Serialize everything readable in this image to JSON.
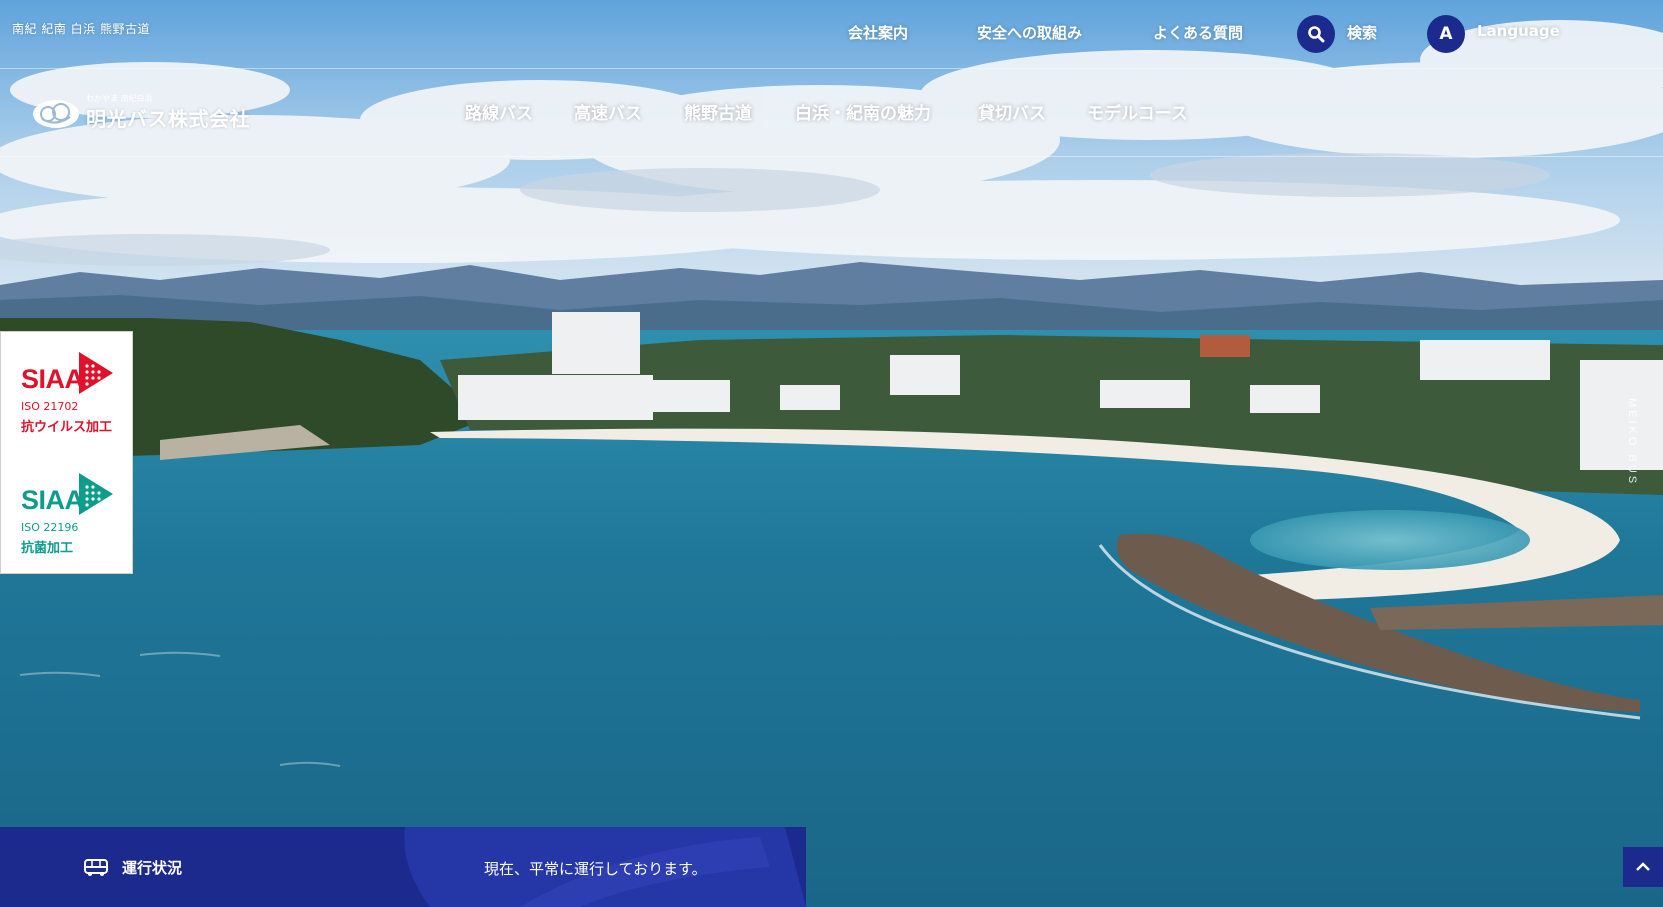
{
  "header": {
    "region_text": "南紀 紀南 白浜 熊野古道",
    "utility_links": [
      {
        "label": "会社案内"
      },
      {
        "label": "安全への取組み"
      },
      {
        "label": "よくある質問"
      }
    ],
    "search": {
      "icon": "search-icon",
      "label": "検索"
    },
    "language": {
      "icon_letter": "A",
      "label": "Language"
    }
  },
  "logo": {
    "ruby": "わかやま 南紀白浜",
    "name": "明光バス株式会社"
  },
  "nav": {
    "items": [
      {
        "label": "路線バス"
      },
      {
        "label": "高速バス"
      },
      {
        "label": "熊野古道"
      },
      {
        "label": "白浜・紀南の魅力"
      },
      {
        "label": "貸切バス"
      },
      {
        "label": "モデルコース"
      }
    ]
  },
  "badges": [
    {
      "title": "SIAA",
      "iso": "ISO 21702",
      "label": "抗ウイルス加工",
      "color": "#e0112b"
    },
    {
      "title": "SIAA",
      "iso": "ISO 22196",
      "label": "抗菌加工",
      "color": "#0e9c8c"
    }
  ],
  "vertical_brand": "MEIKO BUS",
  "status": {
    "icon": "bus-icon",
    "label": "運行状況",
    "message": "現在、平常に運行しております。"
  },
  "back_to_top": {
    "icon": "chevron-up-icon"
  },
  "colors": {
    "navy": "#1b2a8c",
    "siaa_red": "#e0112b",
    "siaa_teal": "#0e9c8c"
  }
}
